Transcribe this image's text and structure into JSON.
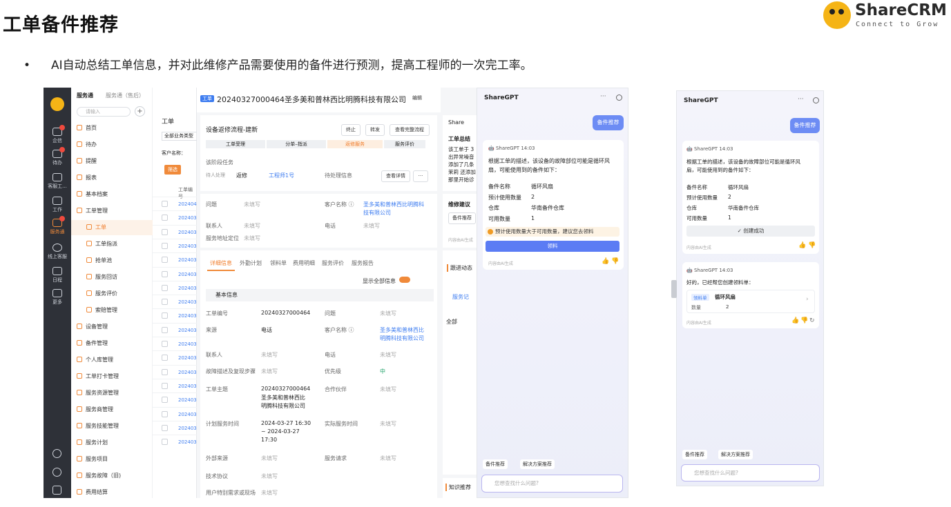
{
  "slide": {
    "title": "工单备件推荐",
    "bullet": "AI自动总结工单信息，并对此维修产品需要使用的备件进行预测，提高工程师的一次完工率。",
    "bullet_mark": "•"
  },
  "logo": {
    "brand": "ShareCRM",
    "tagline": "Connect to Grow"
  },
  "rail": {
    "items": [
      {
        "label": "企信"
      },
      {
        "label": "待办"
      },
      {
        "label": "客服工..."
      },
      {
        "label": "工作"
      },
      {
        "label": "服务通"
      },
      {
        "label": "线上客服"
      },
      {
        "label": "日程"
      },
      {
        "label": "更多"
      }
    ]
  },
  "menu": {
    "app": "服务通",
    "app_sub": "服务通（售后）",
    "search_placeholder": "请输入",
    "items": [
      "首页",
      "待办",
      "提醒",
      "报表",
      "基本档案",
      "工单管理",
      "工单",
      "工单指派",
      "抢单池",
      "服务回访",
      "服务评价",
      "索赔管理",
      "设备管理",
      "备件管理",
      "个人库管理",
      "工单打卡管理",
      "服务资源管理",
      "服务商管理",
      "服务技能管理",
      "服务计划",
      "服务项目",
      "服务故障（旧)",
      "费用结算"
    ]
  },
  "list": {
    "tab": "工单",
    "filter": "全部业务类型",
    "customer_label": "客户名称：",
    "filter_btn": "筛选",
    "col": "工单编号",
    "rows": [
      "2024040",
      "2024032",
      "2024032",
      "2024032",
      "2024032",
      "2024032",
      "2024032",
      "2024032",
      "2024032",
      "2024032",
      "2024032",
      "2024032",
      "2024032",
      "2024032",
      "2024032",
      "2024032",
      "2024032",
      "2024032"
    ]
  },
  "detail": {
    "badge": "工单",
    "title": "20240327000464圣多美和普林西比明腾科技有限公司",
    "edit": "编辑",
    "flow_title": "设备返修流程-建新",
    "flow_btns": [
      "终止",
      "转发",
      "查看完整流程"
    ],
    "steps": [
      "工单受理",
      "分单–指派",
      "返修服务",
      "服务评价"
    ],
    "stage_task": "该阶段任务",
    "assignee_label": "待人处理",
    "assignee_name": "返修",
    "engineer": "工程师1号",
    "pending_label": "待处理信息",
    "view_detail": "查看详情",
    "more": "···",
    "f_problem": "问题",
    "f_problem_v": "未填写",
    "f_customer": "客户名称 ⓘ",
    "f_customer_v1": "圣多美和普林西比明腾科",
    "f_customer_v2": "技有限公司",
    "f_contact": "联系人",
    "f_contact_v": "未填写",
    "f_phone": "电话",
    "f_phone_v": "未填写",
    "f_addr": "服务地址定位",
    "f_addr_v": "未填写",
    "tabs": [
      "详细信息",
      "外勤计划",
      "领料单",
      "费用明细",
      "服务评价",
      "服务报告"
    ],
    "show_all": "显示全部信息",
    "section": "基本信息",
    "rows": [
      {
        "l1": "工单编号",
        "v1": "20240327000464",
        "l2": "问题",
        "v2": "未填写"
      },
      {
        "l1": "来源",
        "v1": "电话",
        "l2": "客户名称 ⓘ",
        "v2": "圣多美和普林西比"
      },
      {
        "l1": "联系人",
        "v1": "未填写",
        "l2": "电话",
        "v2": "未填写"
      },
      {
        "l1": "故障描述及复现步骤",
        "v1": "未填写",
        "l2": "优先级",
        "v2": "中"
      },
      {
        "l1": "工单主题",
        "v1": "20240327000464",
        "l2": "合作伙伴",
        "v2": "未填写"
      },
      {
        "l1": "计划服务时间",
        "v1": "2024-03-27 16:30",
        "l2": "实际服务时间",
        "v2": "未填写"
      },
      {
        "l1": "外部来源",
        "v1": "未填写",
        "l2": "服务请求",
        "v2": "未填写"
      },
      {
        "l1": "技术协议",
        "v1": "未填写",
        "l2": "",
        "v2": ""
      },
      {
        "l1": "用户特别需求或现场",
        "v1": "未填写",
        "l2": "",
        "v2": ""
      }
    ],
    "cust_line2": "明腾科技有限公司",
    "subject_line2": "圣多美和普林西比",
    "subject_line3": "明腾科技有限公司",
    "time_line2": "~ 2024-03-27",
    "time_line3": "17:30"
  },
  "side": {
    "share": "Share",
    "summary": "工单总结",
    "lines": [
      "该工单于 3",
      "出异常噪音",
      "添加了几条",
      "茉莉 还添加",
      "那里开始诊"
    ],
    "suggest": "维修建议",
    "parts_btn": "备件推荐",
    "ai_note": "内容由AI生成",
    "follow": "跟进动态",
    "svc_record": "服务记",
    "all": "全部",
    "knowledge": "知识推荐"
  },
  "chat1": {
    "title": "ShareGPT",
    "dots": "···",
    "req": "备件推荐",
    "bot": "ShareGPT",
    "time": "14:03",
    "msg1": "根据工单的描述，该设备的故障部位可能是循环风",
    "msg2": "扇，可能使用到的备件如下：",
    "k1": "备件名称",
    "v1": "循环风扇",
    "k2": "预计使用数量",
    "v2": "2",
    "k3": "仓库",
    "v3": "华南备件仓库",
    "k4": "可用数量",
    "v4": "1",
    "warn": "预计使用数量大于可用数量，建议您去领料",
    "action": "领料",
    "ai_note": "内容由AI生成",
    "chip1": "备件推荐",
    "chip2": "解决方案推荐",
    "placeholder": "您想查找什么问题?"
  },
  "chat2": {
    "title": "ShareGPT",
    "dots": "···",
    "req": "备件推荐",
    "bot": "ShareGPT",
    "time": "14:03",
    "msg1": "根据工单的描述，该设备的故障部位可能是循环风",
    "msg2": "扇，可能使用到的备件如下：",
    "k1": "备件名称",
    "v1": "循环风扇",
    "k2": "预计使用数量",
    "v2": "2",
    "k3": "仓库",
    "v3": "华南备件仓库",
    "k4": "可用数量",
    "v4": "1",
    "ok": "创建成功",
    "ai_note": "内容由AI生成",
    "bot2": "ShareGPT",
    "time2": "14:03",
    "msg3": "好的，已经帮您创建领料单：",
    "pick_tag": "领料单",
    "pick_name": "循环风扇",
    "qty_label": "数量",
    "qty": "2",
    "ai_note2": "内容由AI生成",
    "chip1": "备件推荐",
    "chip2": "解决方案推荐",
    "placeholder": "您想查找什么问题?"
  }
}
